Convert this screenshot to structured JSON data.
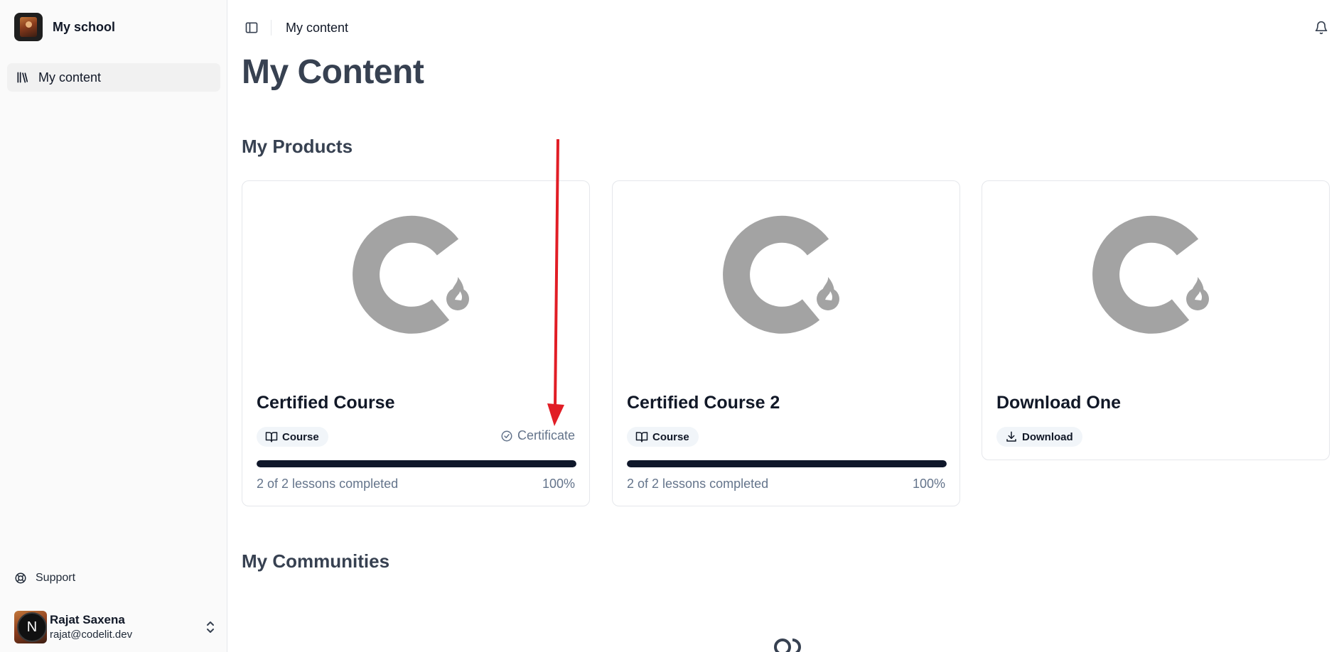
{
  "sidebar": {
    "school_name": "My school",
    "nav": [
      {
        "label": "My content",
        "icon": "library-icon",
        "active": true
      }
    ],
    "support_label": "Support",
    "user": {
      "name": "Rajat Saxena",
      "email": "rajat@codelit.dev",
      "badge_letter": "N"
    }
  },
  "header": {
    "breadcrumb": "My content"
  },
  "main": {
    "page_title": "My Content",
    "products_heading": "My Products",
    "communities_heading": "My Communities",
    "products": [
      {
        "title": "Certified Course",
        "type_label": "Course",
        "type_icon": "book-open-icon",
        "certificate_label": "Certificate",
        "progress_text": "2 of 2 lessons completed",
        "progress_percent": "100%",
        "progress": 1.0
      },
      {
        "title": "Certified Course 2",
        "type_label": "Course",
        "type_icon": "book-open-icon",
        "progress_text": "2 of 2 lessons completed",
        "progress_percent": "100%",
        "progress": 1.0
      },
      {
        "title": "Download One",
        "type_label": "Download",
        "type_icon": "download-icon"
      }
    ]
  },
  "colors": {
    "accent": "#0f172a",
    "annotation_arrow": "#e11d25",
    "placeholder_logo": "#a3a3a3"
  }
}
